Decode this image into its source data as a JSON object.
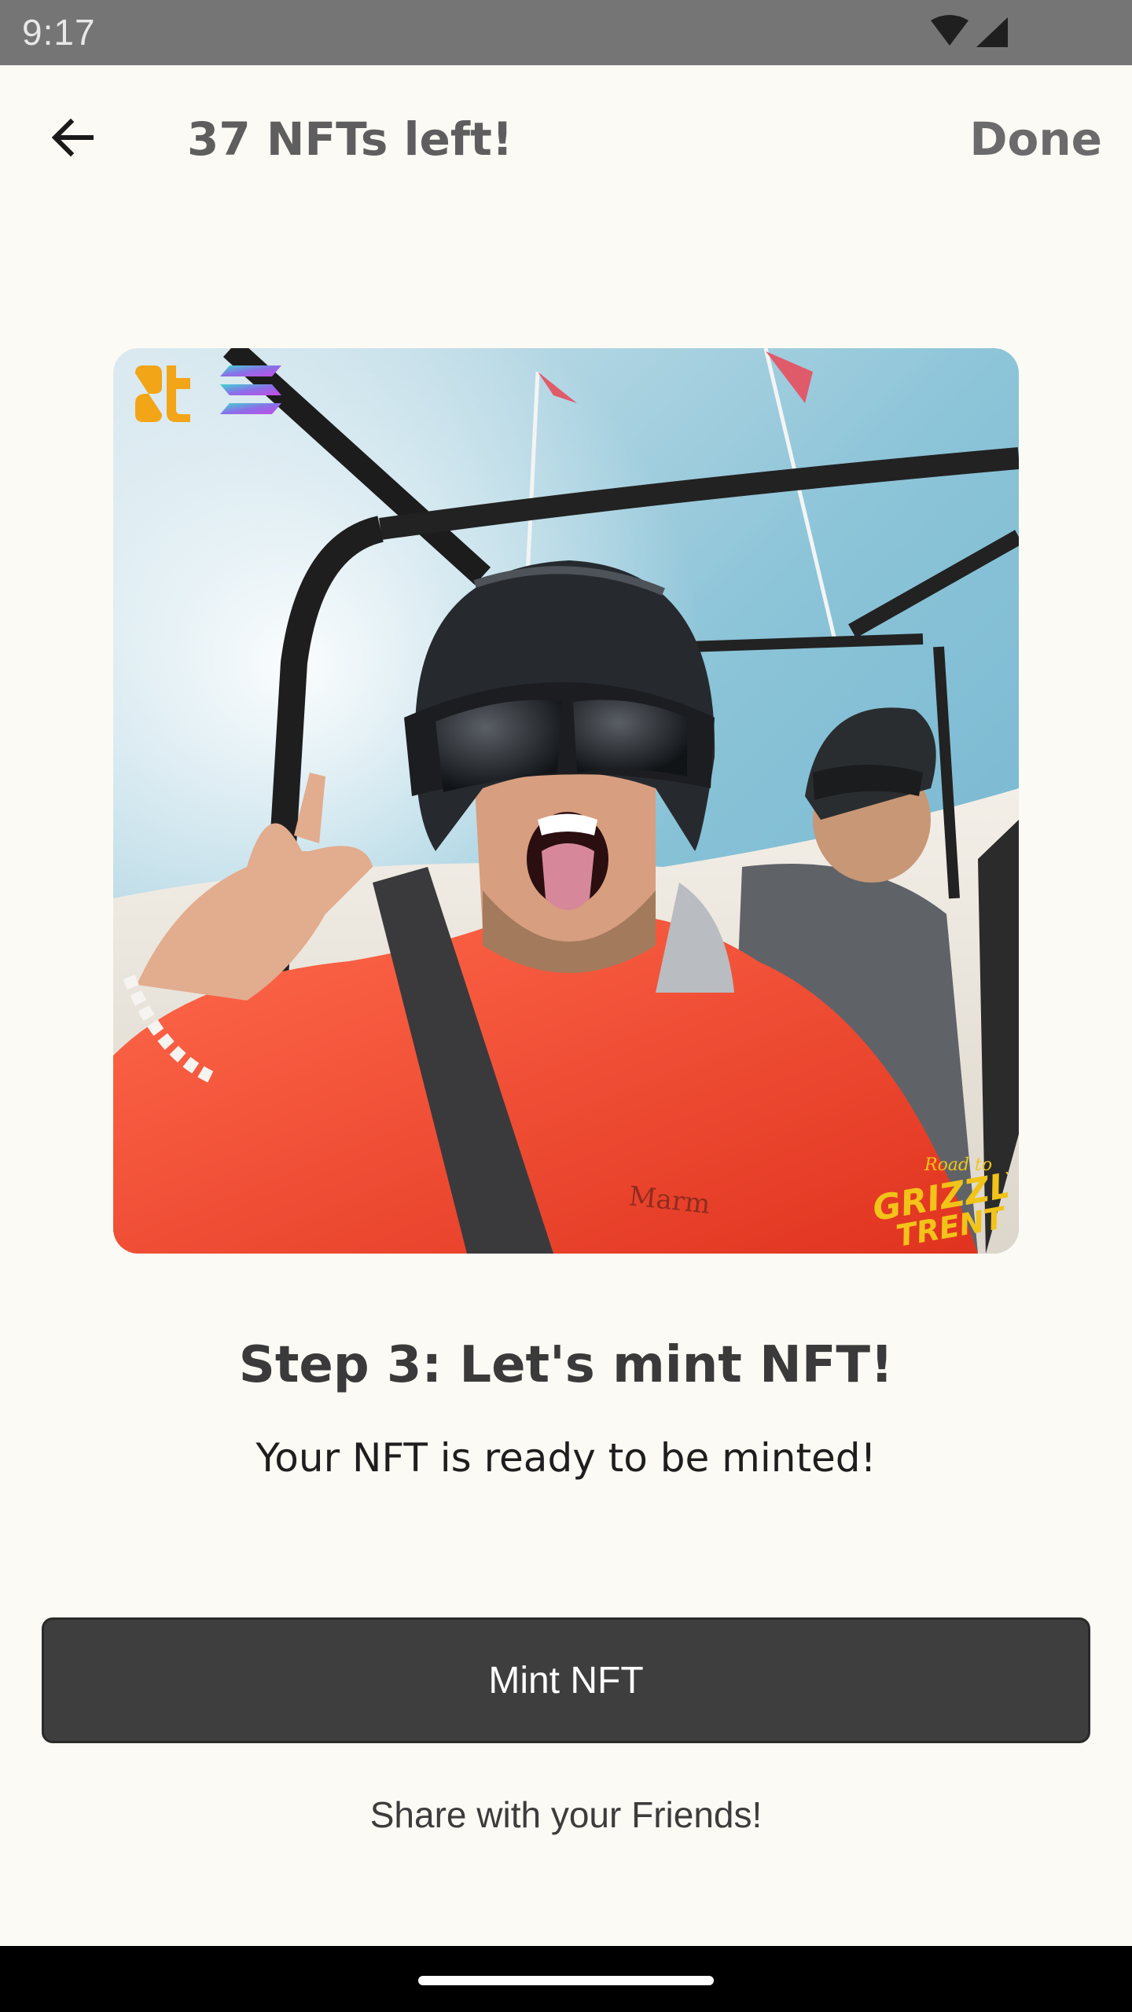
{
  "status_bar": {
    "time": "9:17",
    "icons": [
      "wifi-icon",
      "cellular-signal-icon"
    ]
  },
  "header": {
    "back_icon": "arrow-left-icon",
    "title": "37 NFTs left!",
    "done_label": "Done"
  },
  "nft": {
    "image_description_icon": "photo",
    "badges": [
      "brand-logo-icon",
      "solana-logo-icon"
    ],
    "watermark_lines": [
      "Road to",
      "GRIZZLY",
      "TRENT"
    ]
  },
  "content": {
    "step_title": "Step 3: Let's mint NFT!",
    "step_subtitle": "Your NFT is ready to be minted!"
  },
  "actions": {
    "mint_label": "Mint NFT",
    "share_label": "Share with your Friends!"
  },
  "colors": {
    "background": "#fcfaf4",
    "status_bar": "#757575",
    "mint_button": "#3e3e3e",
    "brand_orange": "#f2a516"
  }
}
